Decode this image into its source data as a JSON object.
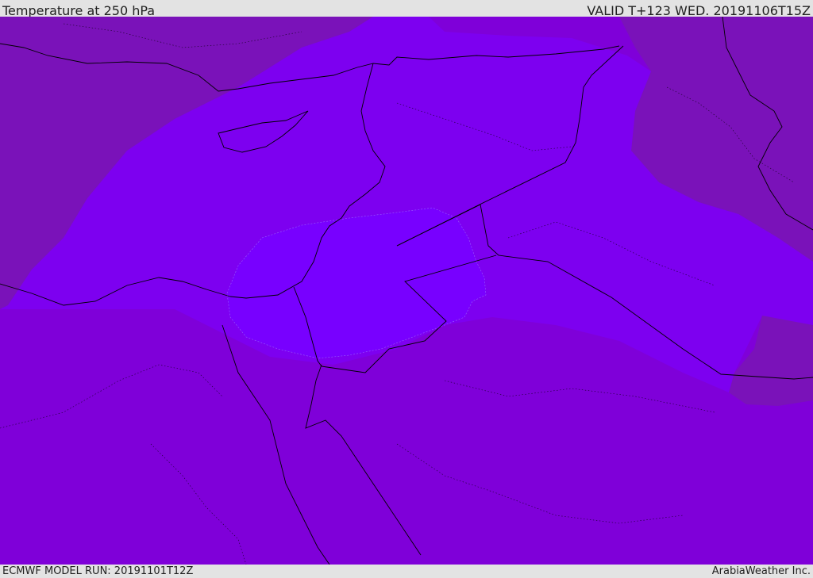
{
  "header": {
    "title": "Temperature at 250 hPa",
    "valid": "VALID T+123 WED. 20191106T15Z"
  },
  "footer": {
    "model_run": "ECMWF MODEL RUN: 20191101T12Z",
    "credit": "ArabiaWeather Inc."
  },
  "colors": {
    "base": "#7f00d9",
    "cold": "#7a12b9",
    "warm": "#7d00f0",
    "warmest": "#7800ff",
    "borders": "#000000",
    "background": "#e3e3e3"
  }
}
